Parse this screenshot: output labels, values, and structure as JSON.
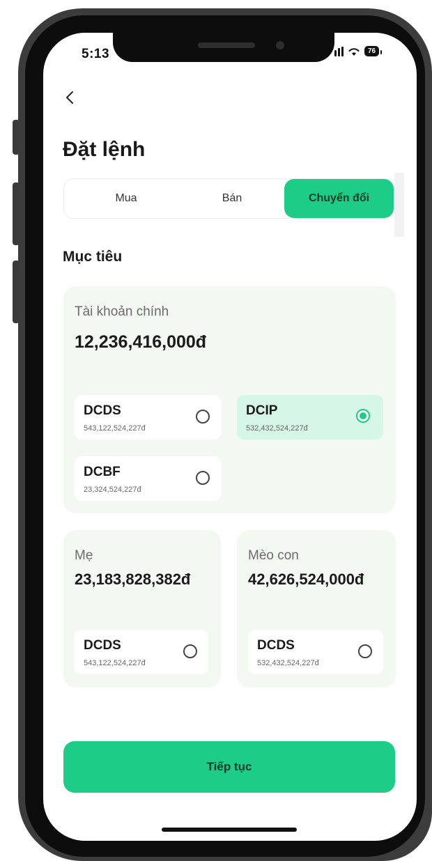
{
  "status": {
    "time": "5:13",
    "battery": "76"
  },
  "header": {
    "title": "Đặt lệnh"
  },
  "tabs": [
    {
      "label": "Mua",
      "active": false
    },
    {
      "label": "Bán",
      "active": false
    },
    {
      "label": "Chuyển đổi",
      "active": true
    }
  ],
  "section_title": "Mục tiêu",
  "main_account": {
    "label": "Tài khoản chính",
    "amount": "12,236,416,000đ",
    "funds": [
      {
        "name": "DCDS",
        "value": "543,122,524,227đ",
        "selected": false
      },
      {
        "name": "DCIP",
        "value": "532,432,524,227đ",
        "selected": true
      },
      {
        "name": "DCBF",
        "value": "23,324,524,227đ",
        "selected": false
      }
    ]
  },
  "sub_accounts": [
    {
      "label": "Mẹ",
      "amount": "23,183,828,382đ",
      "fund": {
        "name": "DCDS",
        "value": "543,122,524,227đ",
        "selected": false
      }
    },
    {
      "label": "Mèo con",
      "amount": "42,626,524,000đ",
      "fund": {
        "name": "DCDS",
        "value": "532,432,524,227đ",
        "selected": false
      }
    }
  ],
  "continue_button": "Tiếp tục",
  "colors": {
    "accent": "#1dcc87",
    "card_bg": "#f3f8f3",
    "selected_bg": "#d6f6e6"
  }
}
